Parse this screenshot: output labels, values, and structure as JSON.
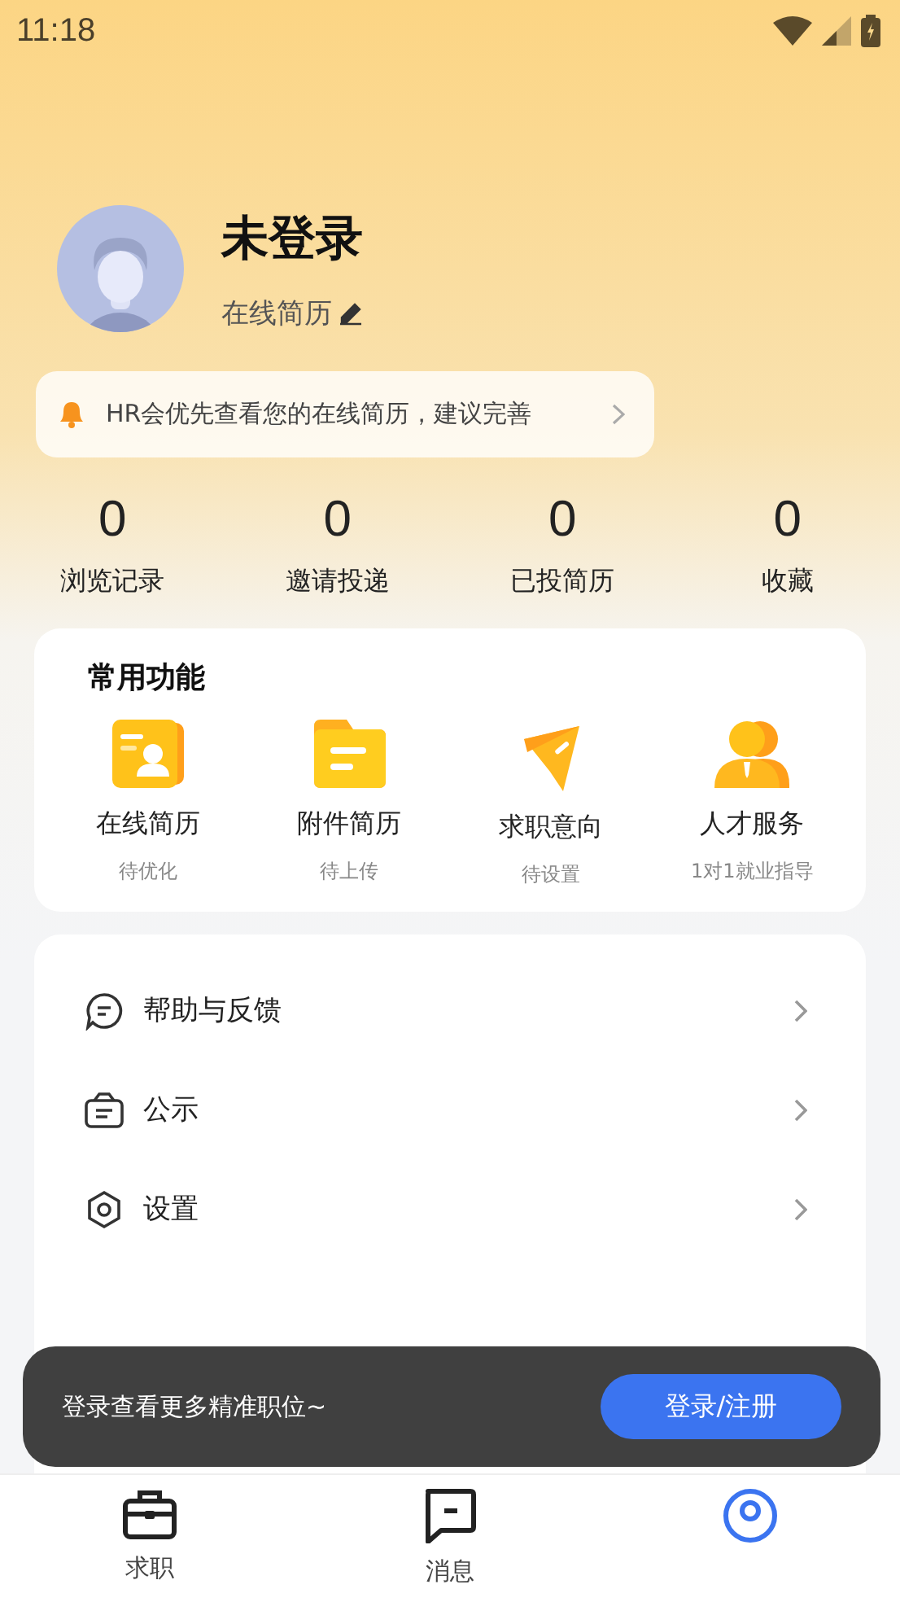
{
  "status_bar": {
    "time": "11:18"
  },
  "profile": {
    "name": "未登录",
    "resume_link": "在线简历"
  },
  "notice": {
    "text": "HR会优先查看您的在线简历，建议完善"
  },
  "stats": [
    {
      "value": "0",
      "label": "浏览记录"
    },
    {
      "value": "0",
      "label": "邀请投递"
    },
    {
      "value": "0",
      "label": "已投简历"
    },
    {
      "value": "0",
      "label": "收藏"
    }
  ],
  "common_functions": {
    "title": "常用功能",
    "items": [
      {
        "kind": "resume",
        "label": "在线简历",
        "sub": "待优化"
      },
      {
        "kind": "folder",
        "label": "附件简历",
        "sub": "待上传"
      },
      {
        "kind": "send",
        "label": "求职意向",
        "sub": "待设置"
      },
      {
        "kind": "person",
        "label": "人才服务",
        "sub": "1对1就业指导"
      }
    ]
  },
  "menu": [
    {
      "kind": "help",
      "label": "帮助与反馈"
    },
    {
      "kind": "notice",
      "label": "公示"
    },
    {
      "kind": "settings",
      "label": "设置"
    }
  ],
  "toast": {
    "text": "登录查看更多精准职位~",
    "button": "登录/注册"
  },
  "tab_bar": [
    {
      "kind": "job",
      "label": "求职",
      "selected": false
    },
    {
      "kind": "message",
      "label": "消息",
      "selected": false
    },
    {
      "kind": "me",
      "selected": true
    }
  ]
}
